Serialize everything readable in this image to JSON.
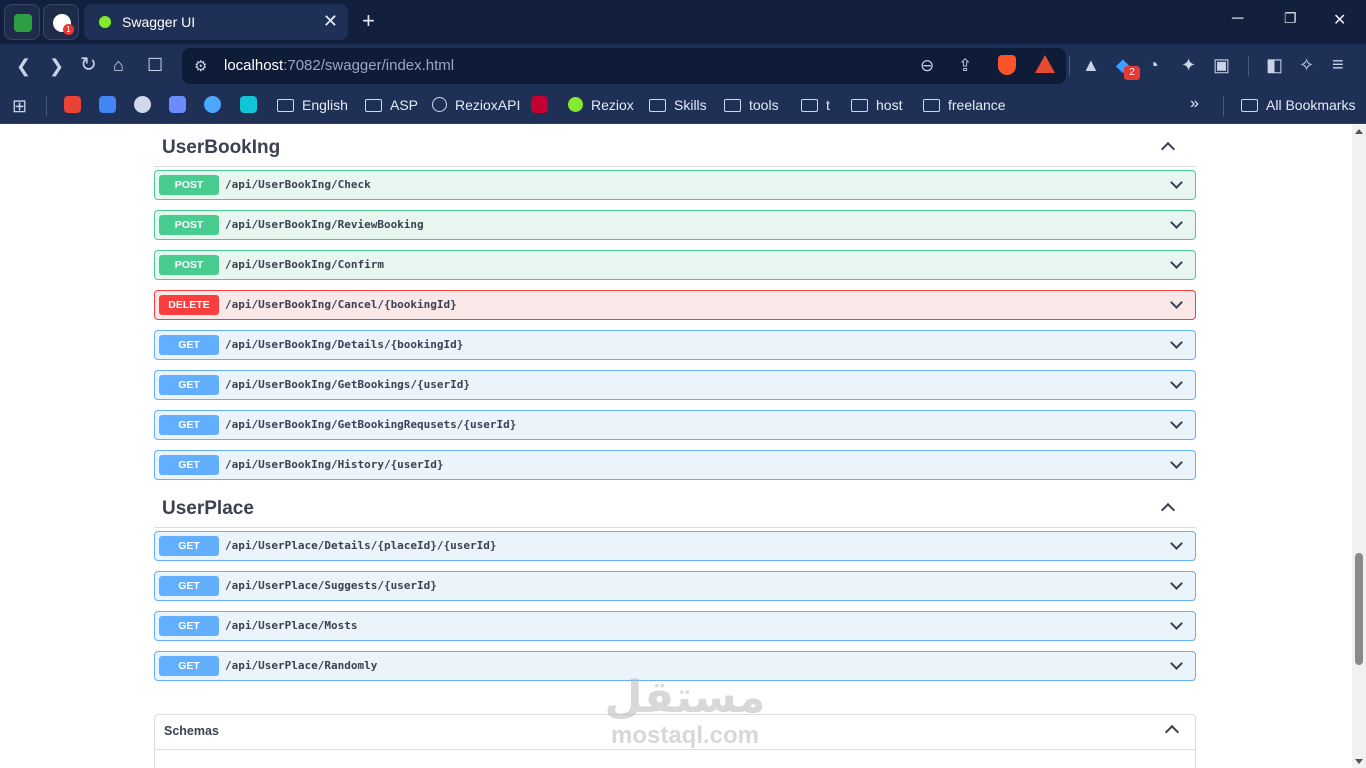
{
  "browser": {
    "tab_title": "Swagger UI",
    "pinned_badge": "1",
    "url_host": "localhost",
    "url_rest": ":7082/swagger/index.html",
    "extension_badge": "2",
    "bookmarks": [
      "English",
      "ASP",
      "RezioxAPI",
      "Reziox",
      "Skills",
      "tools",
      "t",
      "host",
      "freelance"
    ],
    "all_bookmarks": "All Bookmarks"
  },
  "sections": [
    {
      "name": "UserBookIng",
      "operations": [
        {
          "method": "POST",
          "path": "/api/UserBookIng/Check"
        },
        {
          "method": "POST",
          "path": "/api/UserBookIng/ReviewBooking"
        },
        {
          "method": "POST",
          "path": "/api/UserBookIng/Confirm"
        },
        {
          "method": "DELETE",
          "path": "/api/UserBookIng/Cancel/{bookingId}"
        },
        {
          "method": "GET",
          "path": "/api/UserBookIng/Details/{bookingId}"
        },
        {
          "method": "GET",
          "path": "/api/UserBookIng/GetBookings/{userId}"
        },
        {
          "method": "GET",
          "path": "/api/UserBookIng/GetBookingRequsets/{userId}"
        },
        {
          "method": "GET",
          "path": "/api/UserBookIng/History/{userId}"
        }
      ]
    },
    {
      "name": "UserPlace",
      "operations": [
        {
          "method": "GET",
          "path": "/api/UserPlace/Details/{placeId}/{userId}"
        },
        {
          "method": "GET",
          "path": "/api/UserPlace/Suggests/{userId}"
        },
        {
          "method": "GET",
          "path": "/api/UserPlace/Mosts"
        },
        {
          "method": "GET",
          "path": "/api/UserPlace/Randomly"
        }
      ]
    }
  ],
  "schemas_label": "Schemas",
  "watermark": {
    "arabic": "مستقل",
    "latin": "mostaql.com"
  },
  "colors": {
    "post": "#49cc90",
    "get": "#61affe",
    "delete": "#f93e3e",
    "chrome": "#1f3057"
  }
}
